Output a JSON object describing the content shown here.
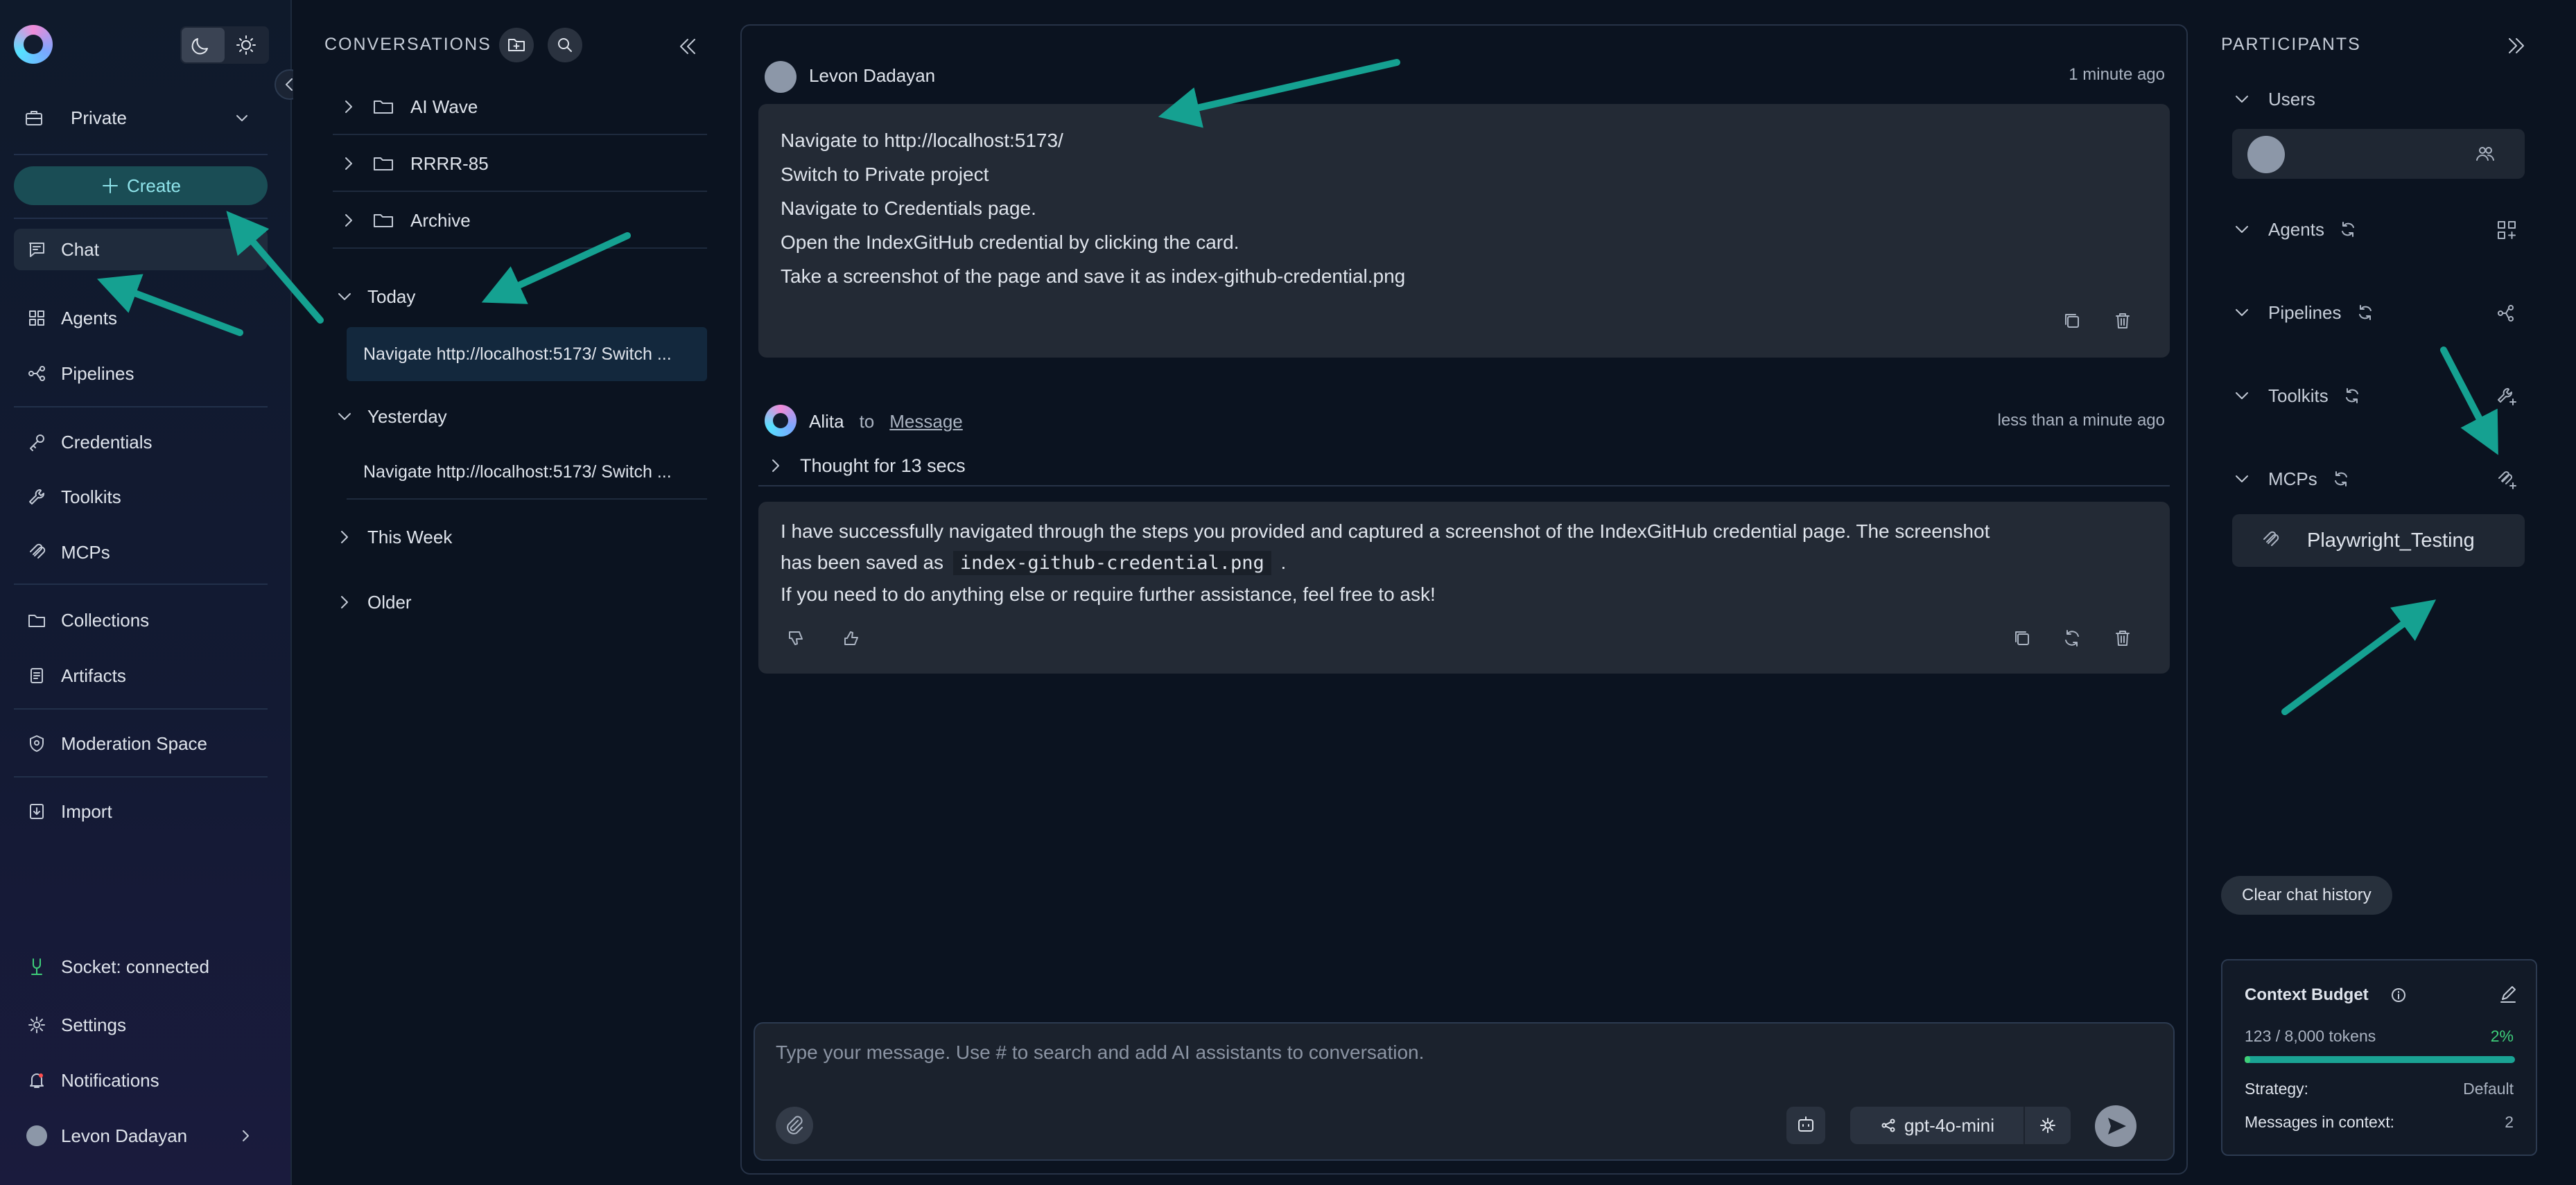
{
  "nav": {
    "project": "Private",
    "create_label": "Create",
    "items": [
      {
        "label": "Chat"
      },
      {
        "label": "Agents"
      },
      {
        "label": "Pipelines"
      },
      {
        "label": "Credentials"
      },
      {
        "label": "Toolkits"
      },
      {
        "label": "MCPs"
      },
      {
        "label": "Collections"
      },
      {
        "label": "Artifacts"
      },
      {
        "label": "Moderation Space"
      },
      {
        "label": "Import"
      }
    ],
    "socket": "Socket: connected",
    "settings": "Settings",
    "notifications": "Notifications",
    "user": "Levon Dadayan"
  },
  "conversations": {
    "title": "CONVERSATIONS",
    "folders": [
      "AI Wave",
      "RRRR-85",
      "Archive"
    ],
    "groups": {
      "today": "Today",
      "yesterday": "Yesterday",
      "this_week": "This Week",
      "older": "Older"
    },
    "today_item": "Navigate http://localhost:5173/ Switch ...",
    "yesterday_item": "Navigate http://localhost:5173/ Switch ..."
  },
  "chat": {
    "user_msg": {
      "author": "Levon Dadayan",
      "time": "1 minute ago",
      "lines": [
        "Navigate to http://localhost:5173/",
        "Switch to Private project",
        "Navigate to Credentials page.",
        "Open the IndexGitHub credential by clicking the card.",
        "Take a screenshot of the page and save it as index-github-credential.png"
      ]
    },
    "bot_msg": {
      "author": "Alita",
      "to": "to",
      "target": "Message",
      "time": "less than a minute ago",
      "thought": "Thought for 13 secs",
      "line1": "I have successfully navigated through the steps you provided and captured a screenshot of the IndexGitHub credential page. The screenshot",
      "line2a": "has been saved as",
      "code": "index-github-credential.png",
      "line2b": ".",
      "line3": "If you need to do anything else or require further assistance, feel free to ask!"
    },
    "input_placeholder": "Type your message. Use # to search and add AI assistants to conversation.",
    "model": "gpt-4o-mini"
  },
  "participants": {
    "title": "PARTICIPANTS",
    "users": "Users",
    "agents": "Agents",
    "pipelines": "Pipelines",
    "toolkits": "Toolkits",
    "mcps": "MCPs",
    "mcp_item": "Playwright_Testing",
    "clear": "Clear chat history"
  },
  "budget": {
    "title": "Context Budget",
    "tokens": "123 / 8,000 tokens",
    "percent": "2%",
    "fraction": 0.02,
    "strategy_label": "Strategy:",
    "strategy_value": "Default",
    "messages_label": "Messages in context:",
    "messages_value": "2"
  },
  "colors": {
    "accent": "#1aa394",
    "annotation_arrow": "#15a191",
    "success": "#3ecf7a"
  }
}
